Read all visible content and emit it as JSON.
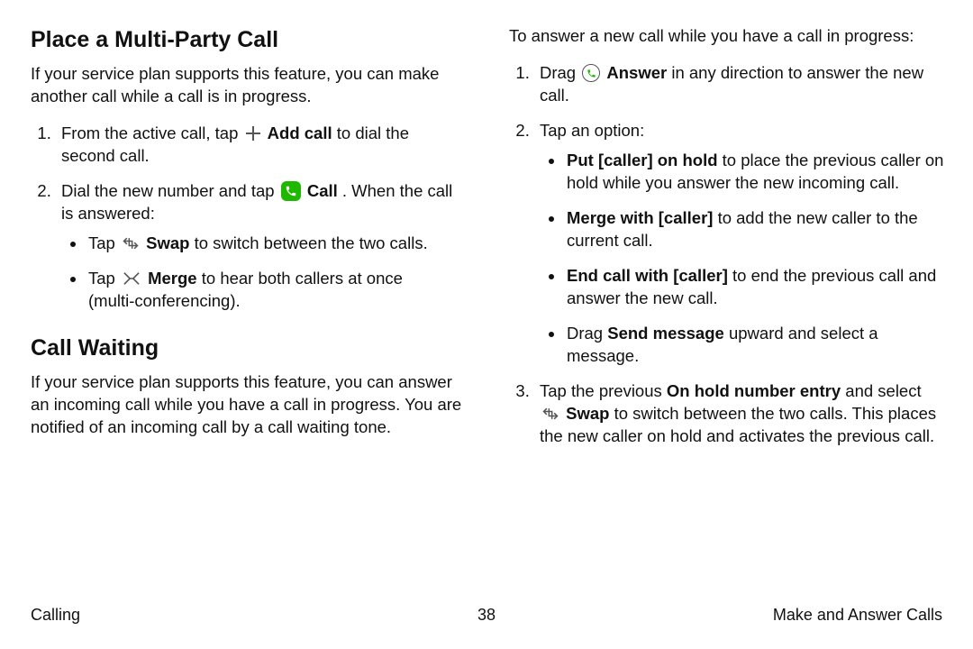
{
  "left": {
    "h1": "Place a Multi-Party Call",
    "intro": "If your service plan supports this feature, you can make another call while a call is in progress.",
    "s1a": "From the active call, tap ",
    "s1b": "Add call",
    "s1c": " to dial the second call.",
    "s2a": "Dial the new number and tap ",
    "s2b": "Call",
    "s2c": ". When the call is answered:",
    "b1a": "Tap ",
    "b1b": "Swap",
    "b1c": " to switch between the two calls.",
    "b2a": "Tap ",
    "b2b": "Merge",
    "b2c": " to hear both callers at once (multi‑conferencing).",
    "h2": "Call Waiting",
    "cwIntro": "If your service plan supports this feature, you can answer an incoming call while you have a call in progress. You are notified of an incoming call by a call waiting tone."
  },
  "right": {
    "lead": "To answer a new call while you have a call in progress:",
    "r1a": "Drag ",
    "r1b": "Answer",
    "r1c": " in any direction to answer the new call.",
    "r2": "Tap an option:",
    "rb1a": "Put [caller] on hold",
    "rb1b": " to place the previous caller on hold while you answer the new incoming call.",
    "rb2a": "Merge with [caller]",
    "rb2b": " to add the new caller to the current call.",
    "rb3a": "End call with [caller]",
    "rb3b": " to end the previous call and answer the new call.",
    "rb4a": "Drag ",
    "rb4b": "Send message",
    "rb4c": " upward and select a message.",
    "r3a": "Tap the previous ",
    "r3b": "On hold number entry",
    "r3c": " and select ",
    "r3d": "Swap",
    "r3e": " to switch between the two calls. This places the new caller on hold and activates the previous call."
  },
  "footer": {
    "left": "Calling",
    "center": "38",
    "right": "Make and Answer Calls"
  }
}
